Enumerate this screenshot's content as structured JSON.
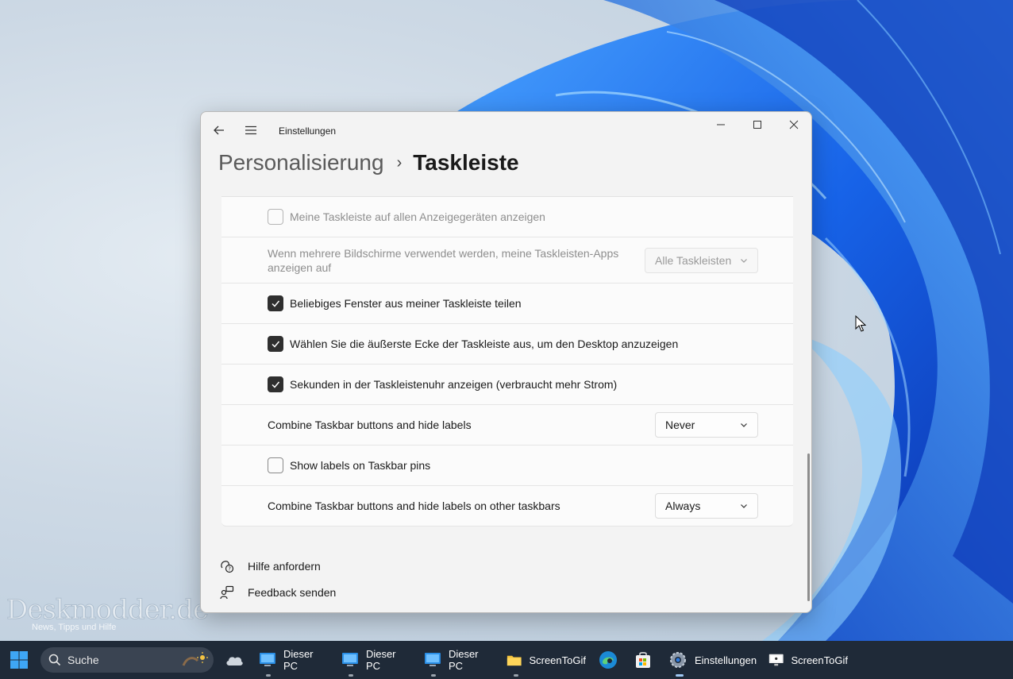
{
  "window": {
    "app_title": "Einstellungen",
    "breadcrumb_parent": "Personalisierung",
    "breadcrumb_separator": "›",
    "breadcrumb_current": "Taskleiste"
  },
  "settings": {
    "show_all_displays": {
      "label": "Meine Taskleiste auf allen Anzeigegeräten anzeigen",
      "checked": false,
      "disabled": true
    },
    "multi_monitor": {
      "label": "Wenn mehrere Bildschirme verwendet werden, meine Taskleisten-Apps anzeigen auf",
      "value": "Alle Taskleisten",
      "disabled": true
    },
    "share_window": {
      "label": "Beliebiges Fenster aus meiner Taskleiste teilen",
      "checked": true
    },
    "corner_desktop": {
      "label": "Wählen Sie die äußerste Ecke der Taskleiste aus, um den Desktop anzuzeigen",
      "checked": true
    },
    "seconds_clock": {
      "label": "Sekunden in der Taskleistenuhr anzeigen (verbraucht mehr Strom)",
      "checked": true
    },
    "combine_buttons": {
      "label": "Combine Taskbar buttons and hide labels",
      "value": "Never"
    },
    "show_labels_pins": {
      "label": "Show labels on Taskbar pins",
      "checked": false
    },
    "combine_other": {
      "label": "Combine Taskbar buttons and hide labels on other taskbars",
      "value": "Always"
    }
  },
  "links": {
    "help": "Hilfe anfordern",
    "feedback": "Feedback senden"
  },
  "watermark": {
    "main": "Deskmodder.de",
    "sub": "News, Tipps und Hilfe"
  },
  "taskbar": {
    "search_placeholder": "Suche",
    "items": [
      {
        "label": "Dieser PC"
      },
      {
        "label": "Dieser PC"
      },
      {
        "label": "Dieser PC"
      },
      {
        "label": "ScreenToGif"
      },
      {
        "label": "Einstellungen"
      },
      {
        "label": "ScreenToGif"
      }
    ]
  },
  "colors": {
    "accent_checkbox": "#2f2f2f",
    "taskbar_bg": "#1f2a38",
    "wallpaper_blue": "#1a5fe0"
  }
}
